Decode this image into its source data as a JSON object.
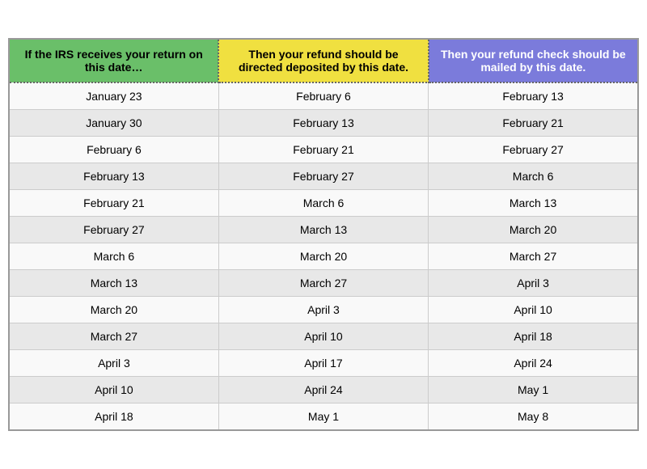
{
  "table": {
    "headers": [
      "If the IRS receives your return on this date…",
      "Then your refund should be directed deposited by this date.",
      "Then your refund check should be mailed by this date."
    ],
    "rows": [
      [
        "January 23",
        "February 6",
        "February 13"
      ],
      [
        "January 30",
        "February 13",
        "February 21"
      ],
      [
        "February 6",
        "February 21",
        "February 27"
      ],
      [
        "February 13",
        "February 27",
        "March 6"
      ],
      [
        "February 21",
        "March 6",
        "March 13"
      ],
      [
        "February 27",
        "March 13",
        "March 20"
      ],
      [
        "March 6",
        "March 20",
        "March 27"
      ],
      [
        "March 13",
        "March 27",
        "April 3"
      ],
      [
        "March 20",
        "April 3",
        "April 10"
      ],
      [
        "March 27",
        "April 10",
        "April 18"
      ],
      [
        "April 3",
        "April 17",
        "April 24"
      ],
      [
        "April 10",
        "April 24",
        "May 1"
      ],
      [
        "April 18",
        "May 1",
        "May 8"
      ]
    ]
  }
}
